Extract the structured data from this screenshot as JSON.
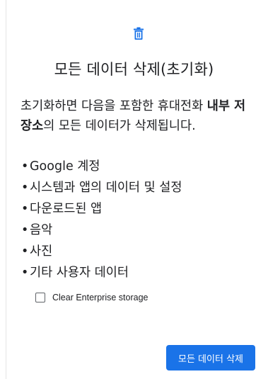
{
  "header": {
    "icon": "trash-icon",
    "title": "모든 데이터 삭제(초기화)"
  },
  "description": {
    "part1": "초기화하면 다음을 포함한 휴대전화 ",
    "bold": "내부 저장소",
    "part2": "의 모든 데이터가 삭제됩니다."
  },
  "bullet_char": "•",
  "bullets": [
    "Google 계정",
    "시스템과 앱의 데이터 및 설정",
    "다운로드된 앱",
    "음악",
    "사진",
    "기타 사용자 데이터"
  ],
  "checkbox": {
    "label": "Clear Enterprise storage",
    "checked": false
  },
  "actions": {
    "erase_label": "모든 데이터 삭제"
  },
  "colors": {
    "accent": "#1a73e8",
    "text": "#202124"
  }
}
